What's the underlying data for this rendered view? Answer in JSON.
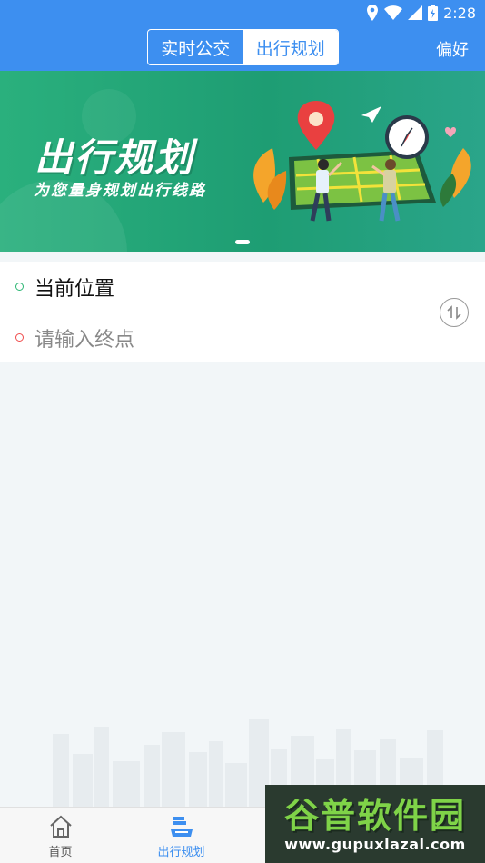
{
  "status_bar": {
    "time": "2:28"
  },
  "header": {
    "tabs": [
      {
        "label": "实时公交",
        "active": false
      },
      {
        "label": "出行规划",
        "active": true
      }
    ],
    "preference_label": "偏好",
    "color": "#3d8ff0"
  },
  "banner": {
    "title": "出行规划",
    "subtitle": "为您量身规划出行线路",
    "page_indicator": {
      "current": 1
    }
  },
  "route": {
    "origin": "当前位置",
    "destination_placeholder": "请输入终点",
    "origin_dot_color": "#2bb673",
    "destination_dot_color": "#f04c4c"
  },
  "bottom_nav": {
    "items": [
      {
        "label": "首页",
        "icon": "home-icon",
        "active": false
      },
      {
        "label": "出行规划",
        "icon": "route-planning-icon",
        "active": true
      },
      {
        "label": "",
        "icon": "nav-item-3-icon",
        "active": false
      },
      {
        "label": "",
        "icon": "nav-item-4-icon",
        "active": false
      }
    ]
  },
  "watermark": {
    "name": "谷普软件园",
    "url": "www.gupuxlazal.com"
  }
}
